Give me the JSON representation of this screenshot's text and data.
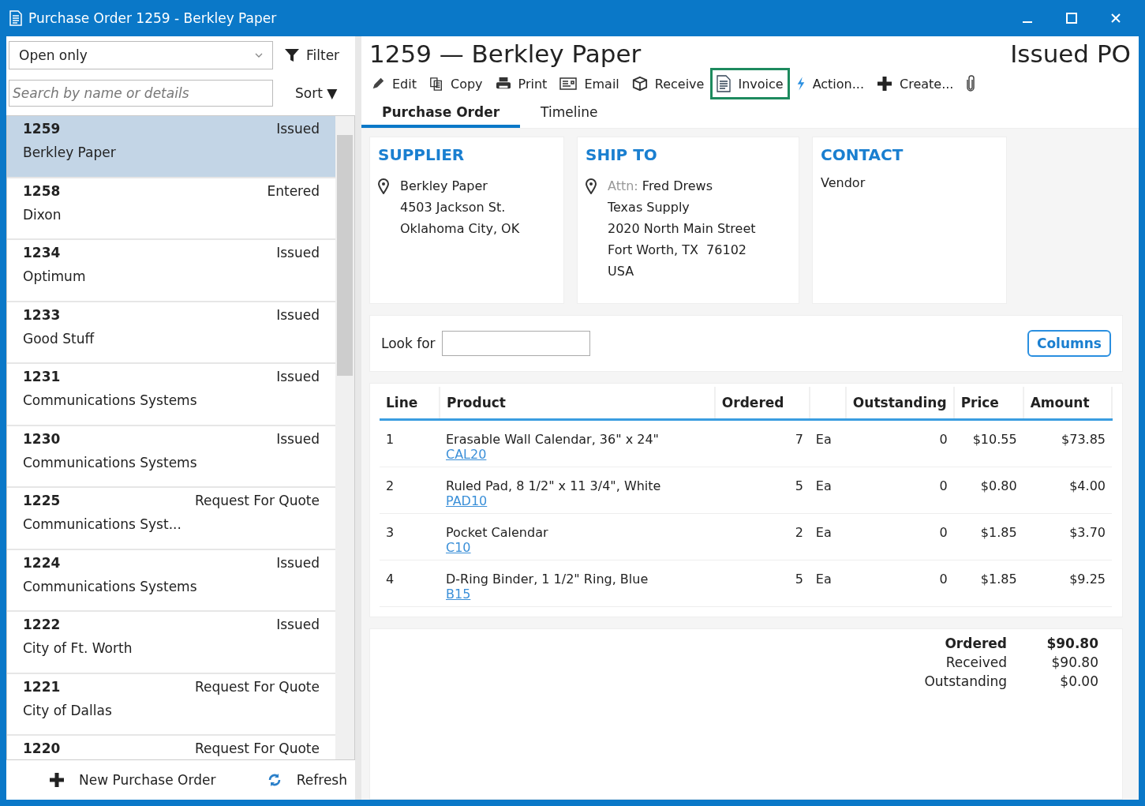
{
  "window": {
    "title": "Purchase Order 1259 - Berkley Paper"
  },
  "sidebar": {
    "filter_select": {
      "value": "Open only"
    },
    "filter_button": "Filter",
    "search": {
      "placeholder": "Search by name or details"
    },
    "sort_button": "Sort ▼",
    "items": [
      {
        "number": "1259",
        "status": "Issued",
        "name": "Berkley Paper",
        "selected": true
      },
      {
        "number": "1258",
        "status": "Entered",
        "name": "Dixon",
        "selected": false
      },
      {
        "number": "1234",
        "status": "Issued",
        "name": "Optimum",
        "selected": false
      },
      {
        "number": "1233",
        "status": "Issued",
        "name": "Good Stuff",
        "selected": false
      },
      {
        "number": "1231",
        "status": "Issued",
        "name": "Communications Systems",
        "selected": false
      },
      {
        "number": "1230",
        "status": "Issued",
        "name": "Communications Systems",
        "selected": false
      },
      {
        "number": "1225",
        "status": "Request For Quote",
        "name": "Communications Syst...",
        "selected": false
      },
      {
        "number": "1224",
        "status": "Issued",
        "name": "Communications Systems",
        "selected": false
      },
      {
        "number": "1222",
        "status": "Issued",
        "name": "City of Ft. Worth",
        "selected": false
      },
      {
        "number": "1221",
        "status": "Request For Quote",
        "name": "City of Dallas",
        "selected": false
      },
      {
        "number": "1220",
        "status": "Request For Quote",
        "selected": false
      }
    ],
    "footer_buttons": [
      {
        "kind": "new",
        "label": "New Purchase Order"
      },
      {
        "kind": "refresh",
        "label": "Refresh"
      }
    ]
  },
  "header": {
    "title": "1259 — Berkley Paper",
    "status": "Issued PO"
  },
  "toolbar": [
    {
      "kind": "edit",
      "label": "Edit",
      "focused": false
    },
    {
      "kind": "copy",
      "label": "Copy",
      "focused": false
    },
    {
      "kind": "print",
      "label": "Print",
      "focused": false
    },
    {
      "kind": "email",
      "label": "Email",
      "focused": false
    },
    {
      "kind": "receive",
      "label": "Receive",
      "focused": false
    },
    {
      "kind": "invoice",
      "label": "Invoice",
      "focused": true
    },
    {
      "kind": "action",
      "label": "Action...",
      "focused": false
    },
    {
      "kind": "create",
      "label": "Create...",
      "focused": false
    },
    {
      "kind": "attach",
      "focused": false
    }
  ],
  "tabs": [
    {
      "label": "Purchase Order",
      "selected": true
    },
    {
      "label": "Timeline",
      "selected": false
    }
  ],
  "supplier": {
    "heading": "SUPPLIER",
    "lines": [
      "Berkley Paper",
      "4503 Jackson St.",
      "Oklahoma City, OK"
    ]
  },
  "ship_to": {
    "heading": "SHIP TO",
    "attn_label": "Attn:",
    "attn_name": "Fred Drews",
    "lines": [
      "Texas Supply",
      "2020 North Main Street",
      "Fort Worth, TX  76102",
      "USA"
    ]
  },
  "contact": {
    "heading": "CONTACT",
    "lines": [
      "Vendor"
    ]
  },
  "look_for": {
    "label": "Look for"
  },
  "columns_button": "Columns",
  "table": {
    "columns": [
      "Line",
      "Product",
      "Ordered",
      "Outstanding",
      "Price",
      "Amount"
    ],
    "rows": [
      {
        "line": "1",
        "product": "Erasable Wall Calendar, 36\" x 24\"",
        "code": "CAL20",
        "ordered": "7",
        "unit": "Ea",
        "outstanding": "0",
        "price": "$10.55",
        "amount": "$73.85"
      },
      {
        "line": "2",
        "product": "Ruled Pad, 8 1/2\" x 11 3/4\", White",
        "code": "PAD10",
        "ordered": "5",
        "unit": "Ea",
        "outstanding": "0",
        "price": "$0.80",
        "amount": "$4.00"
      },
      {
        "line": "3",
        "product": "Pocket Calendar",
        "code": "C10",
        "ordered": "2",
        "unit": "Ea",
        "outstanding": "0",
        "price": "$1.85",
        "amount": "$3.70"
      },
      {
        "line": "4",
        "product": "D-Ring Binder, 1 1/2\" Ring, Blue",
        "code": "B15",
        "ordered": "5",
        "unit": "Ea",
        "outstanding": "0",
        "price": "$1.85",
        "amount": "$9.25"
      }
    ]
  },
  "totals": [
    {
      "label": "Ordered",
      "value": "$90.80",
      "bold": true
    },
    {
      "label": "Received",
      "value": "$90.80",
      "bold": false
    },
    {
      "label": "Outstanding",
      "value": "$0.00",
      "bold": false
    }
  ]
}
